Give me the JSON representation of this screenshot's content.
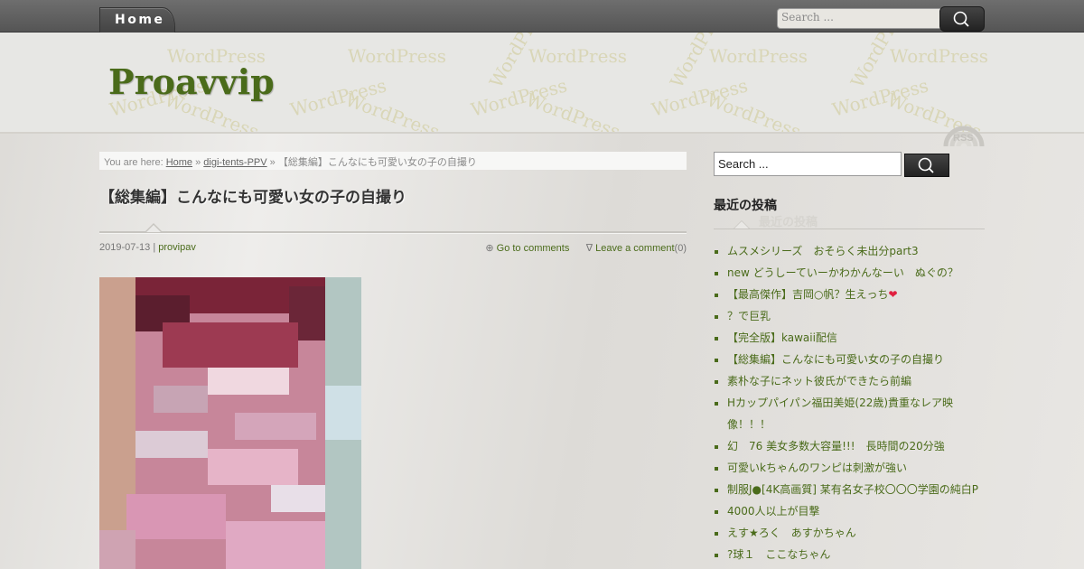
{
  "nav": {
    "home_label": "Home"
  },
  "top_search": {
    "placeholder": "Search ..."
  },
  "header": {
    "site_title": "Proavvip",
    "watermark_text": "WordPress",
    "rss_label": "RSS"
  },
  "breadcrumb": {
    "prefix": "You are here: ",
    "home": "Home",
    "separator": " » ",
    "category": "digi-tents-PPV",
    "current": "【総集編】こんなにも可愛い女の子の自撮り"
  },
  "post": {
    "title": "【総集編】こんなにも可愛い女の子の自撮り",
    "date": "2019-07-13",
    "meta_sep": " | ",
    "author": "provipav",
    "go_to_comments": "Go to comments",
    "leave_comment": "Leave a comment",
    "comment_count": "(0)",
    "icon_comments": "⊕",
    "icon_leave": "∇"
  },
  "sidebar": {
    "search_value": "Search ...",
    "widget_title": "最近の投稿",
    "recent_posts": [
      "ムスメシリーズ　おそらく未出分part3",
      "new どうしーていーかわかんなーい　ぬぐの？",
      "【最高傑作】吉岡○帆？生えっち",
      "？で巨乳",
      "【完全版】kawaii配信",
      "【総集編】こんなにも可愛い女の子の自撮り",
      "素朴な子にネット彼氏ができたら前編",
      "Hカップパイパン福田美姫(22歳)貴重なレア映像！！！",
      "幻　76 美女多数大容量!!!　長時間の20分強",
      "可愛いkちゃんのワンピは刺激が強い",
      "制服J●[4K高画質] 某有名女子校〇〇〇学園の純白P",
      "4000人以上が目撃",
      "えす★ろく　あすかちゃん",
      "?球１　ここなちゃん"
    ],
    "heart_glyph": "❤"
  },
  "colors": {
    "accent": "#4a6b1a",
    "topbar": "#5f5f5f",
    "heart": "#e02040"
  }
}
